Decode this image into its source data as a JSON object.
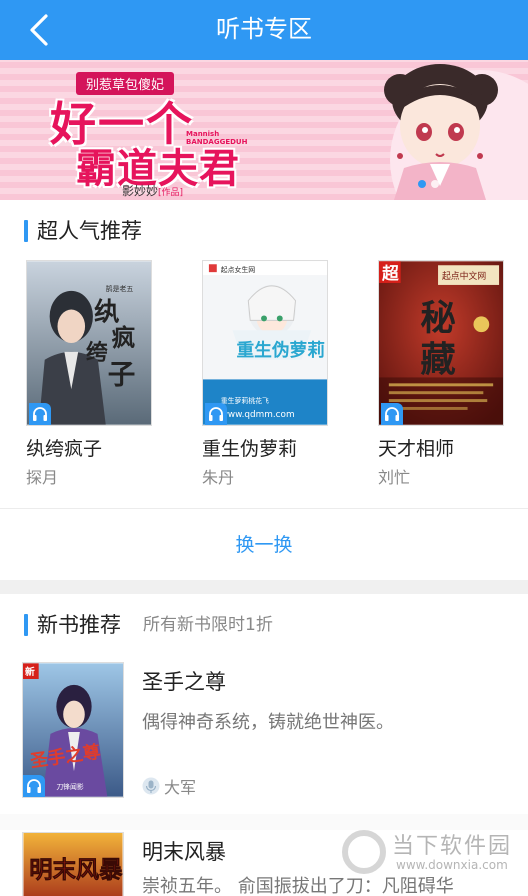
{
  "header": {
    "title": "听书专区",
    "back_icon": "chevron-left-icon"
  },
  "banner": {
    "subtitle": "别惹草包傻妃",
    "title_line1": "好一个",
    "title_line2": "霸道夫君",
    "english": "Mannish BANDAGGEDUH",
    "author": "影妙妙",
    "author_suffix": "[作品]",
    "slides": 2,
    "active_slide": 1
  },
  "popular": {
    "title": "超人气推荐",
    "books": [
      {
        "name": "纨绔疯子",
        "author": "探月",
        "cover_text": "纨绔疯子",
        "cover_author": "鹄是老五"
      },
      {
        "name": "重生伪萝莉",
        "author": "朱丹",
        "cover_text": "重生伪萝莉",
        "cover_site": "www.qdmm.com"
      },
      {
        "name": "天才相师",
        "author": "刘忙",
        "cover_text": "秘藏"
      }
    ],
    "refresh_label": "换一换"
  },
  "new_books": {
    "title": "新书推荐",
    "subtitle": "所有新书限时1折",
    "items": [
      {
        "title": "圣手之尊",
        "desc": "偶得神奇系统，铸就绝世神医。",
        "author": "大军",
        "cover_text": "圣手之尊"
      },
      {
        "title": "明末风暴",
        "desc": "崇祯五年。 俞国振拔出了刀：凡阻碍华",
        "author": "",
        "cover_text": "明末风暴"
      }
    ]
  },
  "watermark": {
    "text": "当下软件园",
    "url": "www.downxia.com"
  },
  "colors": {
    "accent": "#2f98f3",
    "banner_pink": "#f9c6d6",
    "banner_title": "#e6145c"
  }
}
